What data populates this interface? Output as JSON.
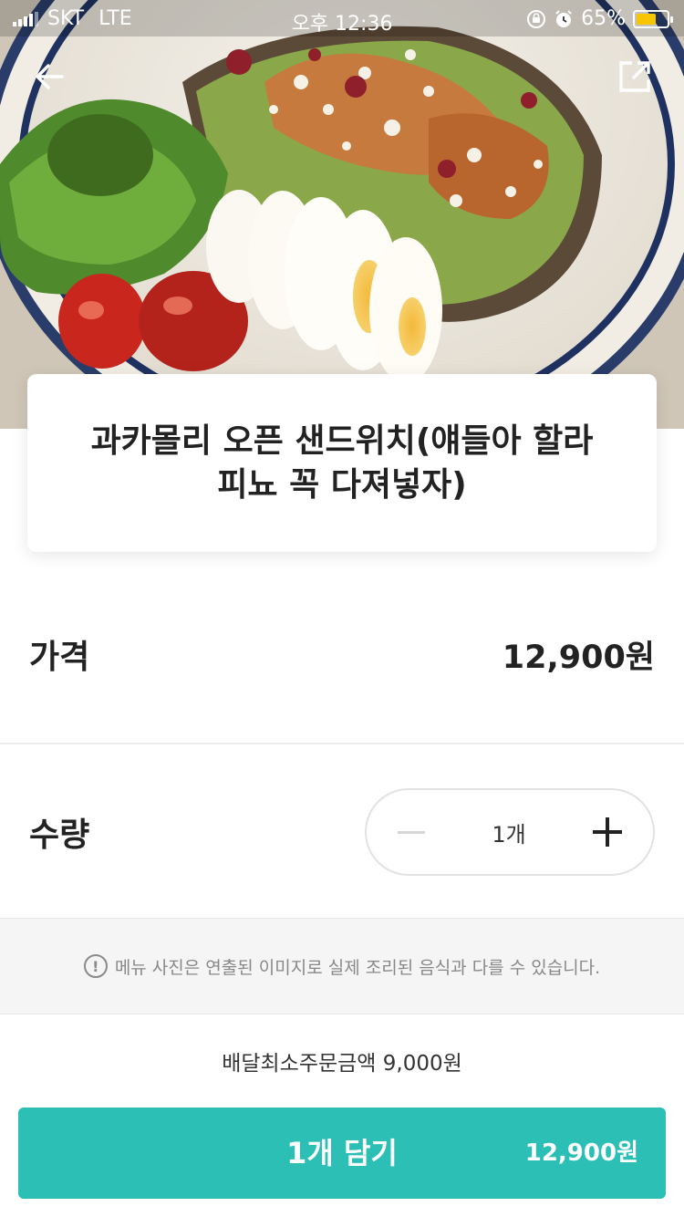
{
  "status_bar": {
    "carrier": "SKT",
    "network": "LTE",
    "time": "오후 12:36",
    "battery_percent_text": "65%",
    "battery_level": 0.65
  },
  "nav": {
    "back_icon": "arrow-left-icon",
    "share_icon": "share-icon"
  },
  "menu": {
    "title": "과카몰리 오픈 샌드위치(얘들아 할라피뇨 꼭 다져넣자)"
  },
  "price": {
    "label": "가격",
    "value": "12,900원"
  },
  "quantity": {
    "label": "수량",
    "value": "1개"
  },
  "notice": {
    "icon": "exclamation-circle-icon",
    "text": "메뉴 사진은 연출된 이미지로 실제 조리된 음식과 다를 수 있습니다."
  },
  "footer": {
    "min_order": "배달최소주문금액 9,000원",
    "cart_button_label": "1개 담기",
    "cart_button_price": "12,900원"
  },
  "colors": {
    "accent": "#2bbfb6",
    "battery": "#f7c600"
  }
}
